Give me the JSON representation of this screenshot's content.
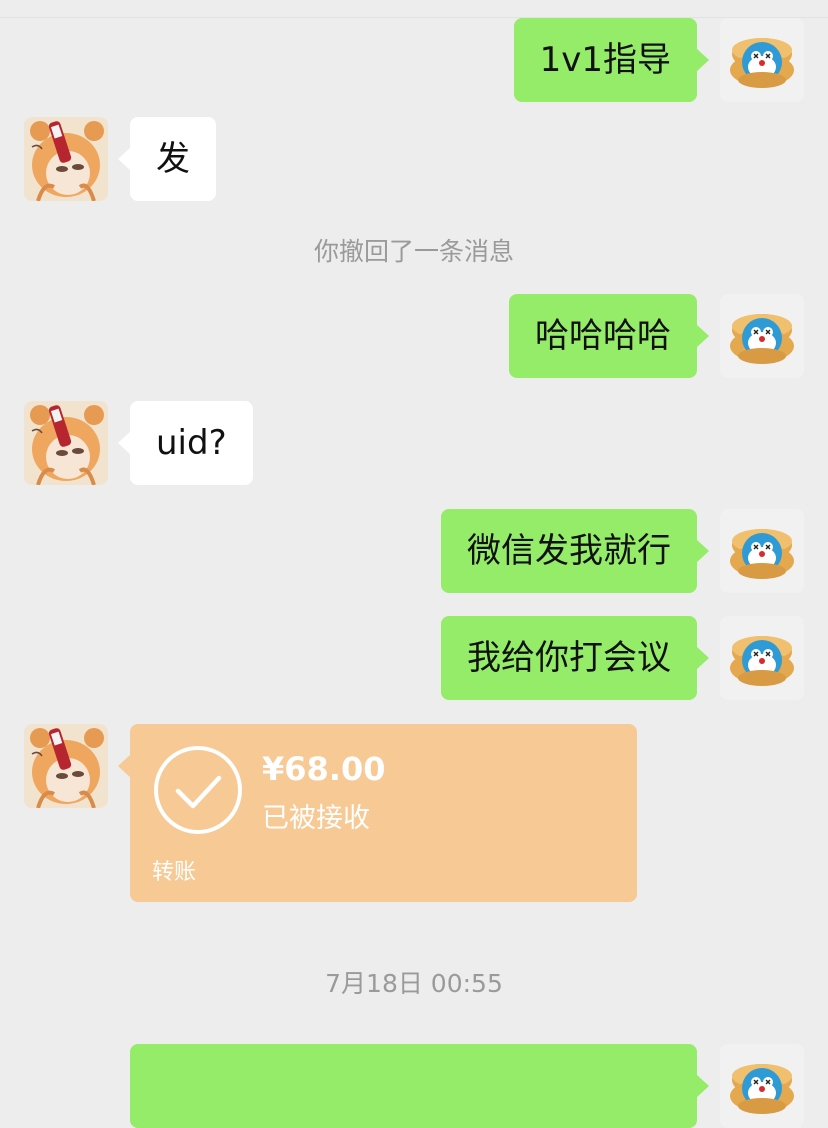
{
  "chat": {
    "messages": [
      {
        "side": "mine",
        "type": "text",
        "text": "1v1指导"
      },
      {
        "side": "theirs",
        "type": "text",
        "text": "发"
      },
      {
        "side": "system",
        "type": "notice",
        "text": "你撤回了一条消息"
      },
      {
        "side": "mine",
        "type": "text",
        "text": "哈哈哈哈"
      },
      {
        "side": "theirs",
        "type": "text",
        "text": "uid?"
      },
      {
        "side": "mine",
        "type": "text",
        "text": "微信发我就行"
      },
      {
        "side": "mine",
        "type": "text",
        "text": "我给你打会议"
      },
      {
        "side": "theirs",
        "type": "transfer",
        "amount": "¥68.00",
        "status": "已被接收",
        "label": "转账"
      },
      {
        "side": "system",
        "type": "timestamp",
        "text": "7月18日 00:55"
      },
      {
        "side": "mine",
        "type": "text",
        "text": ""
      }
    ]
  },
  "colors": {
    "background": "#EDEDED",
    "my_bubble": "#95EC69",
    "their_bubble": "#FFFFFF",
    "transfer_card": "#F7C994",
    "system_text": "#9A9A9A"
  },
  "icons": {
    "my_avatar": "doraemon-dorayaki-avatar",
    "their_avatar": "anime-girl-avatar",
    "transfer_check": "check-circle-icon"
  }
}
